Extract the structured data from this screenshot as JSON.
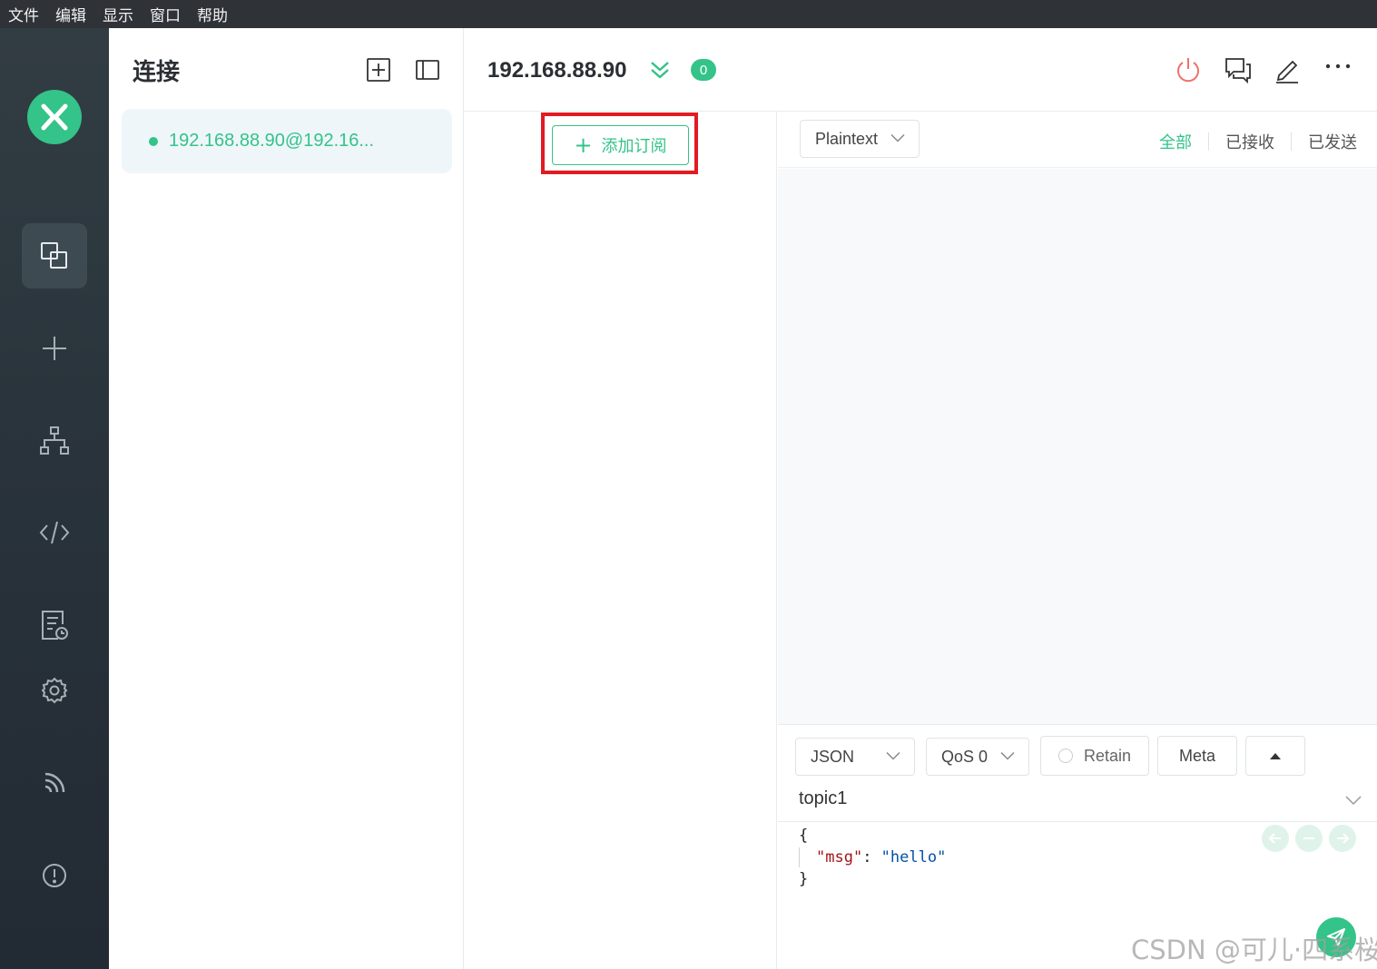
{
  "menu": [
    "文件",
    "编辑",
    "显示",
    "窗口",
    "帮助"
  ],
  "connections": {
    "title": "连接",
    "items": [
      {
        "label": "192.168.88.90@192.16..."
      }
    ]
  },
  "header": {
    "host": "192.168.88.90",
    "badge_count": "0"
  },
  "subscriptions": {
    "add_label": "添加订阅"
  },
  "messages": {
    "format": "Plaintext",
    "filters": [
      "全部",
      "已接收",
      "已发送"
    ],
    "active_filter": "全部"
  },
  "publish": {
    "format": "JSON",
    "qos": "QoS 0",
    "retain_label": "Retain",
    "meta_label": "Meta",
    "topic": "topic1",
    "payload": {
      "open": "{",
      "key": "\"msg\"",
      "colon": ": ",
      "value": "\"hello\"",
      "close": "}"
    }
  },
  "watermark": "CSDN @可儿·四系桜",
  "colors": {
    "accent": "#34c388",
    "highlight": "#e21b23",
    "rail": "#2a343c"
  }
}
